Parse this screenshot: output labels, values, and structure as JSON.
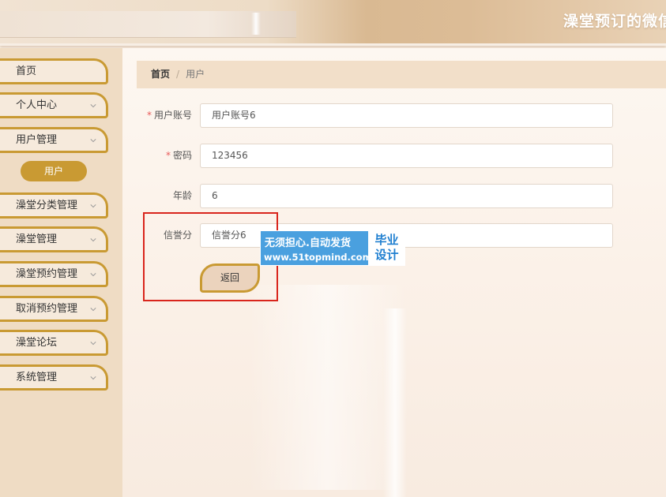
{
  "header": {
    "title": "澡堂预订的微信"
  },
  "sidebar": {
    "items": [
      {
        "label": "首页",
        "has_chevron": false
      },
      {
        "label": "个人中心",
        "has_chevron": true
      },
      {
        "label": "用户管理",
        "has_chevron": true
      },
      {
        "label": "澡堂分类管理",
        "has_chevron": true
      },
      {
        "label": "澡堂管理",
        "has_chevron": true
      },
      {
        "label": "澡堂预约管理",
        "has_chevron": true
      },
      {
        "label": "取消预约管理",
        "has_chevron": true
      },
      {
        "label": "澡堂论坛",
        "has_chevron": true
      },
      {
        "label": "系统管理",
        "has_chevron": true
      }
    ],
    "active_submenu": "用户"
  },
  "breadcrumb": {
    "home": "首页",
    "separator": "/",
    "current": "用户"
  },
  "form": {
    "fields": [
      {
        "label": "用户账号",
        "required": true,
        "value": "用户账号6"
      },
      {
        "label": "密码",
        "required": true,
        "value": "123456"
      },
      {
        "label": "年龄",
        "required": false,
        "value": "6"
      },
      {
        "label": "信誉分",
        "required": false,
        "value": "信誉分6"
      }
    ],
    "required_mark": "*",
    "back_button": "返回"
  },
  "watermark": {
    "line1": "无须担心.自动发货",
    "line2": "www.51topmind.com",
    "box_line1": "毕业",
    "box_line2": "设计"
  },
  "colors": {
    "accent_gold": "#c99a33",
    "sidebar_bg": "#efdcc4",
    "highlight_red": "#d9251c",
    "watermark_blue": "#4aa0df"
  },
  "icons": {
    "chevron": "chevron-down-icon"
  }
}
